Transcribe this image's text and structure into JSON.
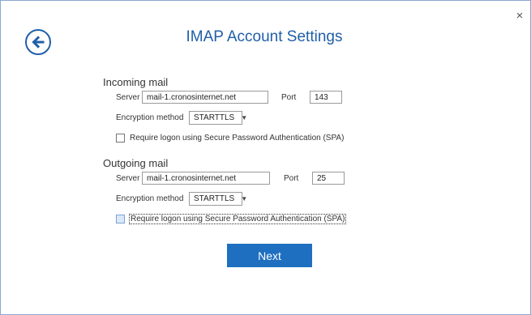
{
  "dialog": {
    "title": "IMAP Account Settings",
    "close_glyph": "×",
    "back_icon": "arrow-left-circle-icon"
  },
  "incoming": {
    "heading": "Incoming mail",
    "server_label": "Server",
    "server_value": "mail-1.cronosinternet.net",
    "port_label": "Port",
    "port_value": "143",
    "encryption_label": "Encryption method",
    "encryption_value": "STARTTLS",
    "spa_label": "Require logon using Secure Password Authentication (SPA)",
    "spa_checked": false
  },
  "outgoing": {
    "heading": "Outgoing mail",
    "server_label": "Server",
    "server_value": "mail-1.cronosinternet.net",
    "port_label": "Port",
    "port_value": "25",
    "encryption_label": "Encryption method",
    "encryption_value": "STARTTLS",
    "spa_label": "Require logon using Secure Password Authentication (SPA)",
    "spa_checked": false
  },
  "actions": {
    "next_label": "Next"
  },
  "colors": {
    "accent": "#1e6fc0",
    "title": "#1f5fa8"
  }
}
